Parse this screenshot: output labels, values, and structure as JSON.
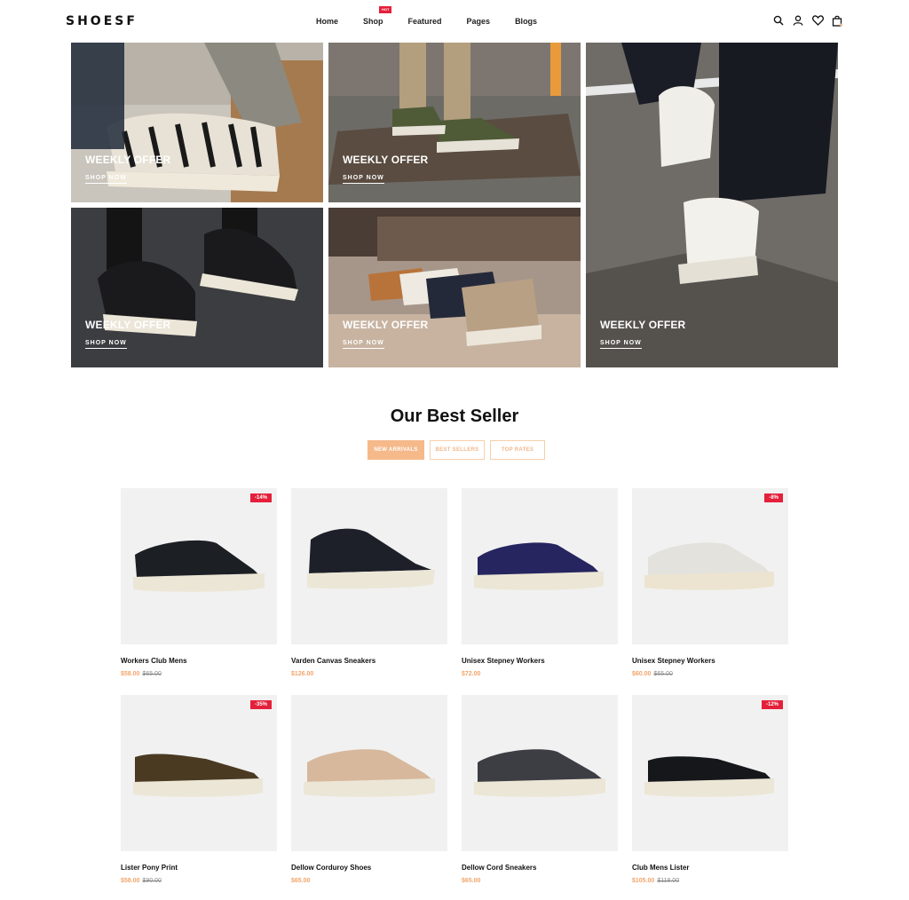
{
  "brand": {
    "logo": "SHOESF",
    "accent": "#f5b98a",
    "sale_red": "#e5203a"
  },
  "nav": {
    "items": [
      {
        "label": "Home"
      },
      {
        "label": "Shop",
        "badge": "HOT"
      },
      {
        "label": "Featured"
      },
      {
        "label": "Pages"
      },
      {
        "label": "Blogs"
      }
    ]
  },
  "header_icons": [
    "search-icon",
    "user-icon",
    "heart-icon",
    "cart-icon"
  ],
  "banners": [
    {
      "title": "WEEKLY OFFER",
      "link": "SHOP NOW"
    },
    {
      "title": "WEEKLY OFFER",
      "link": "SHOP NOW"
    },
    {
      "title": "WEEKLY OFFER",
      "link": "SHOP NOW"
    },
    {
      "title": "WEEKLY OFFER",
      "link": "SHOP NOW"
    },
    {
      "title": "WEEKLY OFFER",
      "link": "SHOP NOW"
    }
  ],
  "best_seller": {
    "title": "Our Best Seller",
    "tabs": [
      "NEW ARRIVALS",
      "BEST SELLERS",
      "TOP RATES"
    ],
    "active_tab": "NEW ARRIVALS"
  },
  "products": [
    {
      "name": "Workers Club Mens",
      "price": "$58.00",
      "old_price": "$65.00",
      "badge": "-14%"
    },
    {
      "name": "Varden Canvas Sneakers",
      "price": "$126.00",
      "old_price": "",
      "badge": ""
    },
    {
      "name": "Unisex Stepney Workers",
      "price": "$72.00",
      "old_price": "",
      "badge": ""
    },
    {
      "name": "Unisex Stepney Workers",
      "price": "$60.00",
      "old_price": "$65.00",
      "badge": "-8%"
    },
    {
      "name": "Lister Pony Print",
      "price": "$58.00",
      "old_price": "$90.00",
      "badge": "-35%"
    },
    {
      "name": "Dellow Corduroy Shoes",
      "price": "$65.00",
      "old_price": "",
      "badge": ""
    },
    {
      "name": "Dellow Cord Sneakers",
      "price": "$65.00",
      "old_price": "",
      "badge": ""
    },
    {
      "name": "Club Mens Lister",
      "price": "$105.00",
      "old_price": "$118.00",
      "badge": "-12%"
    }
  ]
}
